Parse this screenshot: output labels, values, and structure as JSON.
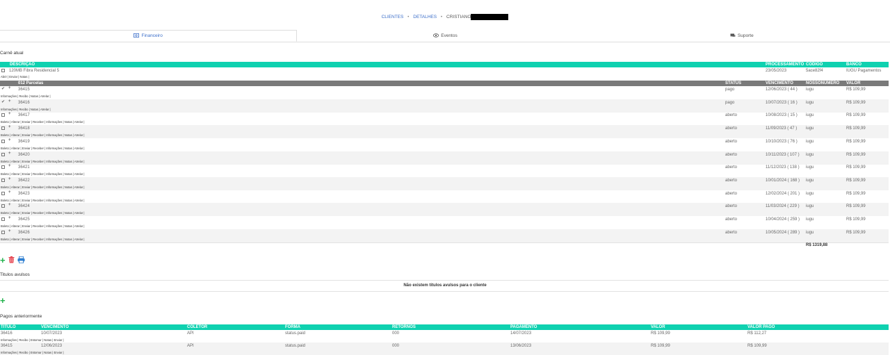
{
  "breadcrumb": {
    "clientes": "CLIENTES",
    "detalhes": "DETALHES",
    "cliente": "CRISTIANO"
  },
  "tabs": [
    {
      "label": "Financeiro",
      "icon": "money-icon"
    },
    {
      "label": "Eventos",
      "icon": "eye-icon"
    },
    {
      "label": "Suporte",
      "icon": "chat-icon"
    }
  ],
  "carne": {
    "title": "Carnê atual",
    "headers": {
      "descricao": "DESCRIÇÃO",
      "processamento": "PROCESSAMENTO",
      "codigo": "CODIGO",
      "banco": "BANCO"
    },
    "descricao": "120MB Fibra Residencial 5",
    "processamento": "23/05/2023",
    "codigo": "5ace82f4",
    "banco": "IUGU Pagamentos",
    "actions": "Abrir | Enviar | Notas |",
    "parcelas_headers": {
      "parcelas": "012 Parcelas",
      "status": "STATUS",
      "vencimento": "VENCIMENTO",
      "nossonumero": "NOSSONUMERO",
      "valor": "VALOR"
    },
    "parcelas": [
      {
        "id": "36415",
        "status": "pago",
        "venc": "12/06/2023 ( 44 )",
        "nn": "iugu",
        "valor": "R$ 109,99",
        "paid": true,
        "actions": "Informações | Recibo | Notas | Atrelar |"
      },
      {
        "id": "36416",
        "status": "pago",
        "venc": "10/07/2023 ( 16 )",
        "nn": "iugu",
        "valor": "R$ 109,99",
        "paid": true,
        "actions": "Informações | Recibo | Notas | Atrelar |"
      },
      {
        "id": "36417",
        "status": "aberto",
        "venc": "10/08/2023 ( 15 )",
        "nn": "iugu",
        "valor": "R$ 109,99",
        "paid": false,
        "actions": "Boleto | Alterar | Enviar | Receber | Informações | Notas | Atrelar |"
      },
      {
        "id": "36418",
        "status": "aberto",
        "venc": "11/09/2023 ( 47 )",
        "nn": "iugu",
        "valor": "R$ 109,99",
        "paid": false,
        "actions": "Boleto | Alterar | Enviar | Receber | Informações | Notas | Atrelar |"
      },
      {
        "id": "36419",
        "status": "aberto",
        "venc": "10/10/2023 ( 76 )",
        "nn": "iugu",
        "valor": "R$ 109,99",
        "paid": false,
        "actions": "Boleto | Alterar | Enviar | Receber | Informações | Notas | Atrelar |"
      },
      {
        "id": "36420",
        "status": "aberto",
        "venc": "10/11/2023 ( 107 )",
        "nn": "iugu",
        "valor": "R$ 109,99",
        "paid": false,
        "actions": "Boleto | Alterar | Enviar | Receber | Informações | Notas | Atrelar |"
      },
      {
        "id": "36421",
        "status": "aberto",
        "venc": "11/12/2023 ( 138 )",
        "nn": "iugu",
        "valor": "R$ 109,99",
        "paid": false,
        "actions": "Boleto | Alterar | Enviar | Receber | Informações | Notas | Atrelar |"
      },
      {
        "id": "36422",
        "status": "aberto",
        "venc": "10/01/2024 ( 168 )",
        "nn": "iugu",
        "valor": "R$ 109,99",
        "paid": false,
        "actions": "Boleto | Alterar | Enviar | Receber | Informações | Notas | Atrelar |"
      },
      {
        "id": "36423",
        "status": "aberto",
        "venc": "12/02/2024 ( 201 )",
        "nn": "iugu",
        "valor": "R$ 109,99",
        "paid": false,
        "actions": "Boleto | Alterar | Enviar | Receber | Informações | Notas | Atrelar |"
      },
      {
        "id": "36424",
        "status": "aberto",
        "venc": "11/03/2024 ( 229 )",
        "nn": "iugu",
        "valor": "R$ 109,99",
        "paid": false,
        "actions": "Boleto | Alterar | Enviar | Receber | Informações | Notas | Atrelar |"
      },
      {
        "id": "36425",
        "status": "aberto",
        "venc": "10/04/2024 ( 259 )",
        "nn": "iugu",
        "valor": "R$ 109,99",
        "paid": false,
        "actions": "Boleto | Alterar | Enviar | Receber | Informações | Notas | Atrelar |"
      },
      {
        "id": "36426",
        "status": "aberto",
        "venc": "10/05/2024 ( 289 )",
        "nn": "iugu",
        "valor": "R$ 109,99",
        "paid": false,
        "actions": "Boleto | Alterar | Enviar | Receber | Informações | Notas | Atrelar |"
      }
    ],
    "total": "R$ 1319,88"
  },
  "avulsos": {
    "title": "Titulos avulsos",
    "empty": "Não existem titulos avulsos para o cliente"
  },
  "pagos": {
    "title": "Pagos anteriormente",
    "headers": {
      "titulo": "TITULO",
      "vencimento": "VENCIMENTO",
      "coletor": "COLETOR",
      "forma": "FORMA",
      "retornos": "RETORNOS",
      "pagamento": "PAGAMENTO",
      "valor": "VALOR",
      "valor_pago": "VALOR PAGO"
    },
    "rows": [
      {
        "titulo": "36416",
        "venc": "10/07/2023",
        "coletor": "API",
        "forma": "status.paid",
        "retornos": "000",
        "pagamento": "14/07/2023",
        "valor": "R$ 109,99",
        "valor_pago": "R$ 112,27",
        "actions": "Informações | Recibo | Estornar | Notas | Enviar |"
      },
      {
        "titulo": "36415",
        "venc": "12/06/2023",
        "coletor": "API",
        "forma": "status.paid",
        "retornos": "000",
        "pagamento": "13/06/2023",
        "valor": "R$ 109,99",
        "valor_pago": "R$ 109,99",
        "actions": "Informações | Recibo | Estornar | Notas | Enviar |"
      }
    ]
  },
  "colors": {
    "accent": "#0fd1b0",
    "link": "#3b6ec9",
    "success": "#22b24c",
    "danger": "#e53945",
    "print": "#2f7fd1"
  }
}
